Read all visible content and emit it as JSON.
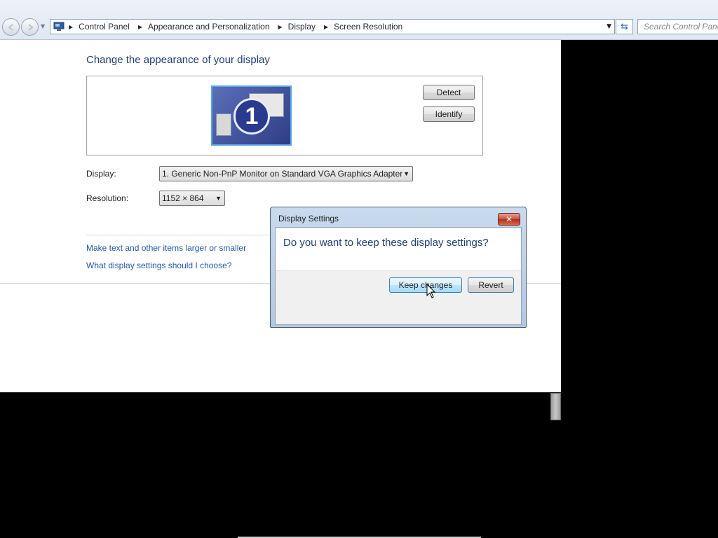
{
  "address_bar": {
    "breadcrumbs": [
      {
        "label": "Control Panel"
      },
      {
        "label": "Appearance and Personalization"
      },
      {
        "label": "Display"
      },
      {
        "label": "Screen Resolution"
      }
    ],
    "search_placeholder": "Search Control Panel"
  },
  "page": {
    "title": "Change the appearance of your display",
    "monitor_number": "1",
    "detect_label": "Detect",
    "identify_label": "Identify",
    "display_label": "Display:",
    "display_value": "1. Generic Non-PnP Monitor on Standard VGA Graphics Adapter",
    "resolution_label": "Resolution:",
    "resolution_value": "1152 × 864",
    "links": [
      {
        "label": "Make text and other items larger or smaller"
      },
      {
        "label": "What display settings should I choose?"
      }
    ]
  },
  "dialog": {
    "title": "Display Settings",
    "question": "Do you want to keep these display settings?",
    "keep_label": "Keep changes",
    "revert_label": "Revert"
  },
  "icons": [
    "back-icon",
    "forward-icon",
    "control-panel-icon",
    "refresh-icon",
    "close-icon",
    "chevron-down-icon",
    "cursor-icon"
  ]
}
